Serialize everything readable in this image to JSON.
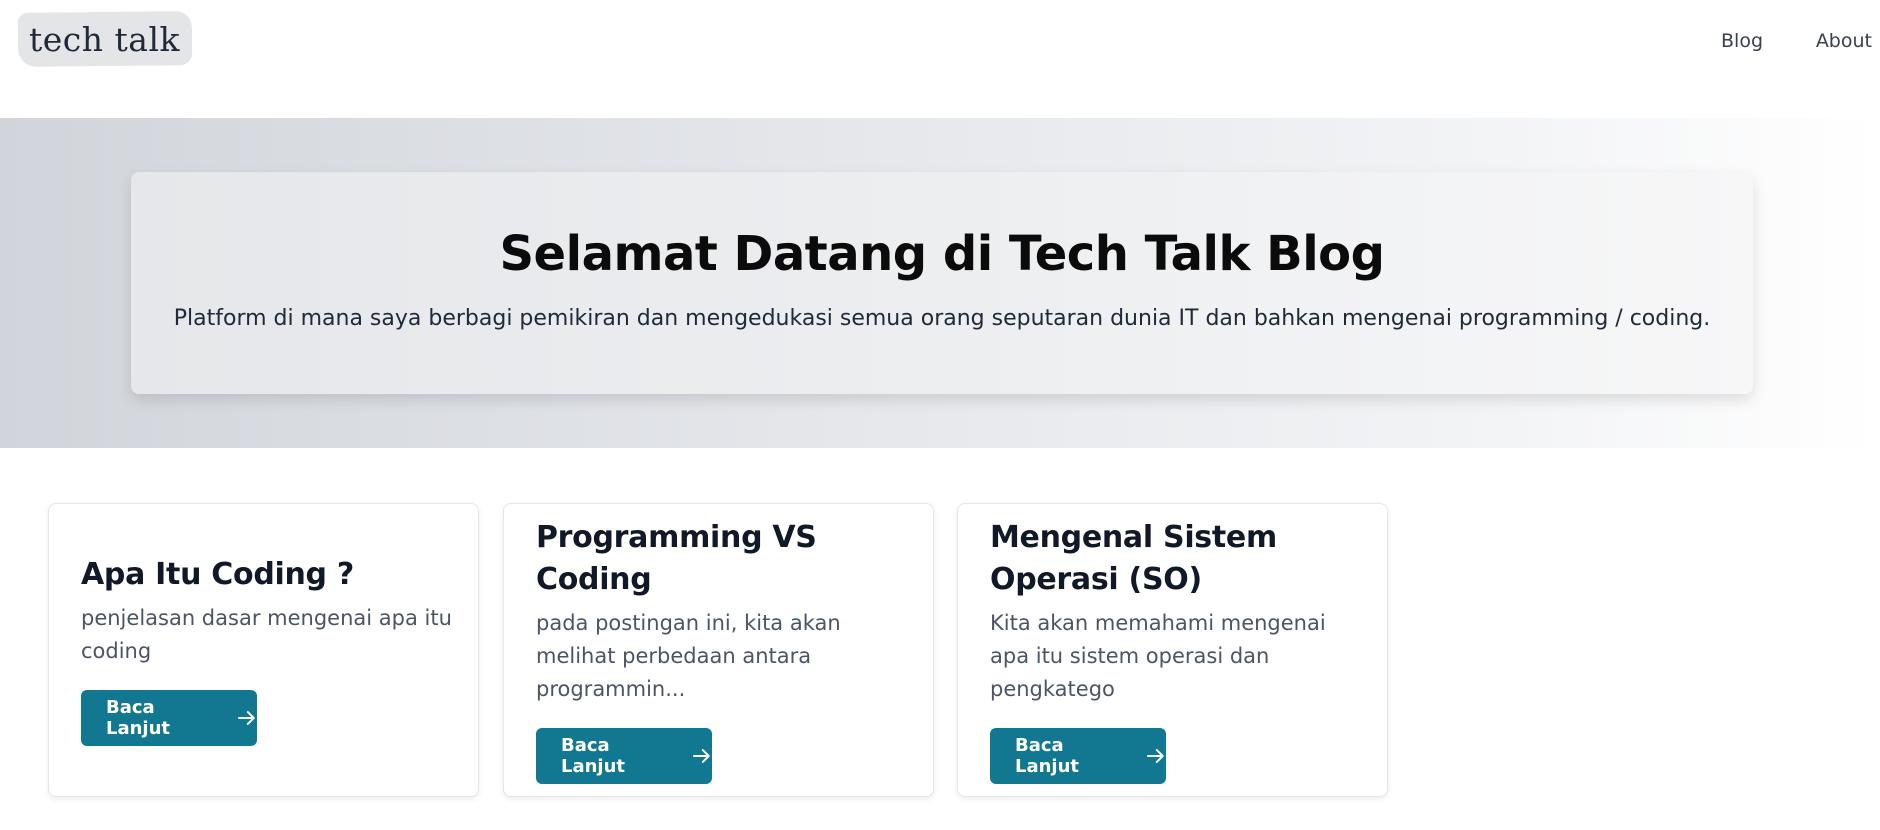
{
  "header": {
    "logo_text": "tech talk",
    "nav": [
      {
        "label": "Blog"
      },
      {
        "label": "About"
      }
    ]
  },
  "hero": {
    "title": "Selamat Datang di Tech Talk Blog",
    "subtitle": "Platform di mana saya berbagi pemikiran dan mengedukasi semua orang seputaran dunia IT dan bahkan mengenai programming / coding."
  },
  "posts": [
    {
      "title": "Apa Itu Coding ?",
      "excerpt": "penjelasan dasar mengenai apa itu coding",
      "button_label": "Baca Lanjut"
    },
    {
      "title": "Programming VS Coding",
      "excerpt": "pada postingan ini, kita akan melihat perbedaan antara programmin...",
      "button_label": "Baca Lanjut"
    },
    {
      "title": "Mengenal Sistem Operasi (SO)",
      "excerpt": "Kita akan memahami mengenai apa itu sistem operasi dan pengkatego",
      "button_label": "Baca Lanjut"
    }
  ],
  "icons": {
    "button_arrow": "arrow-right-icon"
  },
  "colors": {
    "accent": "#127791",
    "logo_bg": "#e4e5e7",
    "hero_gradient_start": "#d1d5db",
    "hero_gradient_end": "#ffffff"
  }
}
